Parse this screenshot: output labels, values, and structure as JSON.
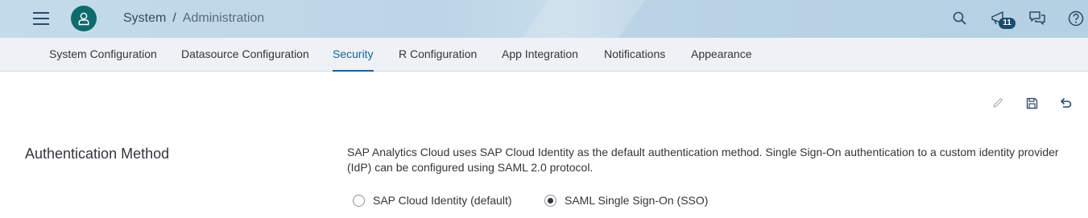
{
  "shell": {
    "breadcrumb": [
      "System",
      "Administration"
    ],
    "breadcrumb_separator": "/",
    "notification_count": "11",
    "icons": [
      "menu-icon",
      "user-icon",
      "search-icon",
      "notifications-icon",
      "feedback-icon",
      "help-icon"
    ]
  },
  "tabs": [
    {
      "label": "System Configuration",
      "active": false
    },
    {
      "label": "Datasource Configuration",
      "active": false
    },
    {
      "label": "Security",
      "active": true
    },
    {
      "label": "R Configuration",
      "active": false
    },
    {
      "label": "App Integration",
      "active": false
    },
    {
      "label": "Notifications",
      "active": false
    },
    {
      "label": "Appearance",
      "active": false
    }
  ],
  "toolbar": {
    "icons": [
      "edit-icon",
      "save-icon",
      "undo-icon"
    ]
  },
  "auth": {
    "title": "Authentication Method",
    "description": "SAP Analytics Cloud uses SAP Cloud Identity as the default authentication method. Single Sign-On authentication to a custom identity provider (IdP) can be configured using SAML 2.0 protocol.",
    "options": [
      {
        "label": "SAP Cloud Identity (default)",
        "selected": false
      },
      {
        "label": "SAML Single Sign-On (SSO)",
        "selected": true
      }
    ]
  },
  "colors": {
    "accent": "#1a6496",
    "avatar": "#0e6b6b",
    "badge": "#1a4c6d",
    "shell_bg": "#bcd6e7",
    "tabbar_bg": "#eef2f6"
  }
}
